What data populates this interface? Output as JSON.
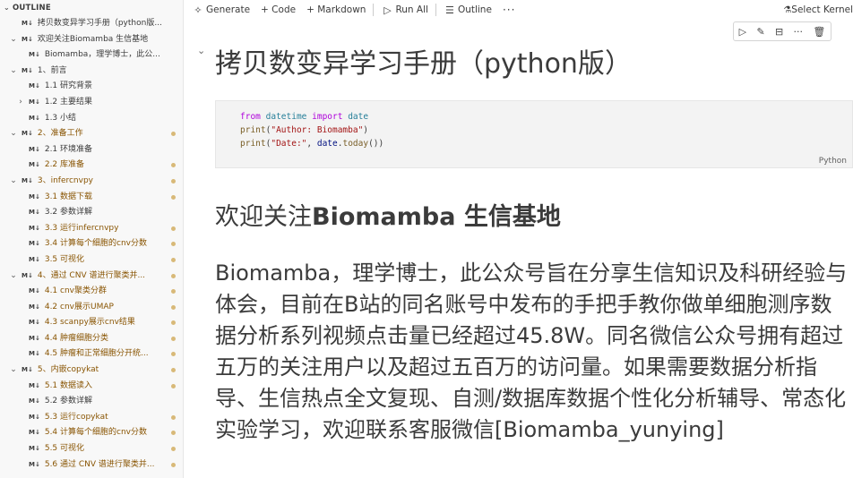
{
  "outline": {
    "header": "OUTLINE",
    "md_badge": "M↓",
    "items": [
      {
        "label": "拷贝数变异学习手册（python版...",
        "indent": 1,
        "twisty": "",
        "modified": false
      },
      {
        "label": "欢迎关注Biomamba 生信基地",
        "indent": 1,
        "twisty": "⌄",
        "modified": false
      },
      {
        "label": "Biomamba，理学博士，此公...",
        "indent": 2,
        "twisty": "",
        "modified": false
      },
      {
        "label": "1、前言",
        "indent": 1,
        "twisty": "⌄",
        "modified": false
      },
      {
        "label": "1.1 研究背景",
        "indent": 2,
        "twisty": "",
        "modified": false
      },
      {
        "label": "1.2 主要结果",
        "indent": 2,
        "twisty": "›",
        "modified": false
      },
      {
        "label": "1.3 小结",
        "indent": 2,
        "twisty": "",
        "modified": false
      },
      {
        "label": "2、准备工作",
        "indent": 1,
        "twisty": "⌄",
        "modified": true
      },
      {
        "label": "2.1 环境准备",
        "indent": 2,
        "twisty": "",
        "modified": false
      },
      {
        "label": "2.2 库准备",
        "indent": 2,
        "twisty": "",
        "modified": true
      },
      {
        "label": "3、infercnvpy",
        "indent": 1,
        "twisty": "⌄",
        "modified": true
      },
      {
        "label": "3.1 数据下载",
        "indent": 2,
        "twisty": "",
        "modified": true
      },
      {
        "label": "3.2 参数详解",
        "indent": 2,
        "twisty": "",
        "modified": false
      },
      {
        "label": "3.3 运行infercnvpy",
        "indent": 2,
        "twisty": "",
        "modified": true
      },
      {
        "label": "3.4 计算每个细胞的cnv分数",
        "indent": 2,
        "twisty": "",
        "modified": true
      },
      {
        "label": "3.5 可视化",
        "indent": 2,
        "twisty": "",
        "modified": true
      },
      {
        "label": "4、通过 CNV 谱进行聚类并...",
        "indent": 1,
        "twisty": "⌄",
        "modified": true
      },
      {
        "label": "4.1 cnv聚类分群",
        "indent": 2,
        "twisty": "",
        "modified": true
      },
      {
        "label": "4.2 cnv展示UMAP",
        "indent": 2,
        "twisty": "",
        "modified": true
      },
      {
        "label": "4.3 scanpy展示cnv结果",
        "indent": 2,
        "twisty": "",
        "modified": true
      },
      {
        "label": "4.4 肿瘤细胞分类",
        "indent": 2,
        "twisty": "",
        "modified": true
      },
      {
        "label": "4.5 肿瘤和正常细胞分开统...",
        "indent": 2,
        "twisty": "",
        "modified": true
      },
      {
        "label": "5、内嵌copykat",
        "indent": 1,
        "twisty": "⌄",
        "modified": true
      },
      {
        "label": "5.1 数据读入",
        "indent": 2,
        "twisty": "",
        "modified": true
      },
      {
        "label": "5.2 参数详解",
        "indent": 2,
        "twisty": "",
        "modified": false
      },
      {
        "label": "5.3 运行copykat",
        "indent": 2,
        "twisty": "",
        "modified": true
      },
      {
        "label": "5.4 计算每个细胞的cnv分数",
        "indent": 2,
        "twisty": "",
        "modified": true
      },
      {
        "label": "5.5 可视化",
        "indent": 2,
        "twisty": "",
        "modified": true
      },
      {
        "label": "5.6 通过 CNV 谱进行聚类并...",
        "indent": 2,
        "twisty": "",
        "modified": true
      }
    ]
  },
  "toolbar": {
    "generate": "Generate",
    "code": "+ Code",
    "markdown": "+ Markdown",
    "run_all": "Run All",
    "outline": "Outline",
    "more": "···",
    "select_kernel": "Select Kernel"
  },
  "cell_toolbar": {
    "run": "▷",
    "edit": "✎",
    "split": "⊟",
    "more": "···",
    "delete": "🗑"
  },
  "notebook": {
    "title": "拷贝数变异学习手册（python版）",
    "code_lang": "Python",
    "heading_prefix": "欢迎关注",
    "heading_bold": "Biomamba 生信基地",
    "paragraph": "Biomamba，理学博士，此公众号旨在分享生信知识及科研经验与体会，目前在B站的同名账号中发布的手把手教你做单细胞测序数据分析系列视频点击量已经超过45.8W。同名微信公众号拥有超过五万的关注用户以及超过五百万的访问量。如果需要数据分析指导、生信热点全文复现、自测/数据库数据个性化分析辅导、常态化实验学习，欢迎联系客服微信[Biomamba_yunying]"
  },
  "code": {
    "line1_kw1": "from",
    "line1_mod": "datetime",
    "line1_kw2": "import",
    "line1_name": "date",
    "line2_fn": "print",
    "line2_str": "\"Author: Biomamba\"",
    "line3_fn": "print",
    "line3_str": "\"Date:\"",
    "line3_var": "date",
    "line3_call": "today"
  }
}
